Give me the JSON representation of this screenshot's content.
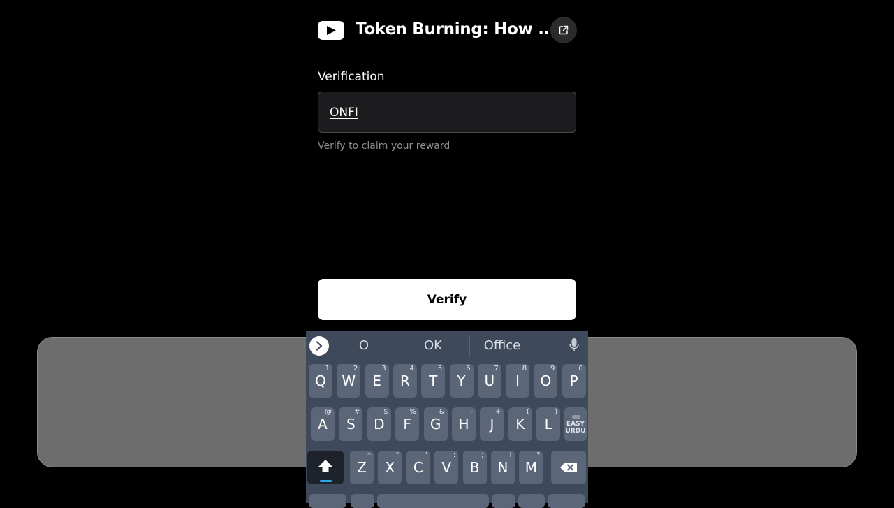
{
  "header": {
    "app_icon": "youtube-icon",
    "title": "Token Burning: How ...",
    "external_link_icon": "external-link-icon"
  },
  "form": {
    "label": "Verification",
    "input_value": "ONFI",
    "helper_text": "Verify to claim your reward",
    "submit_label": "Verify"
  },
  "keyboard": {
    "suggestions": [
      "O",
      "OK",
      "Office"
    ],
    "expand_icon": "chevron-right-icon",
    "mic_icon": "microphone-icon",
    "row1": [
      {
        "key": "Q",
        "alt": "1"
      },
      {
        "key": "W",
        "alt": "2"
      },
      {
        "key": "E",
        "alt": "3"
      },
      {
        "key": "R",
        "alt": "4"
      },
      {
        "key": "T",
        "alt": "5"
      },
      {
        "key": "Y",
        "alt": "6"
      },
      {
        "key": "U",
        "alt": "7"
      },
      {
        "key": "I",
        "alt": "8"
      },
      {
        "key": "O",
        "alt": "9"
      },
      {
        "key": "P",
        "alt": "0"
      }
    ],
    "row2": [
      {
        "key": "A",
        "alt": "@"
      },
      {
        "key": "S",
        "alt": "#"
      },
      {
        "key": "D",
        "alt": "$"
      },
      {
        "key": "F",
        "alt": "%"
      },
      {
        "key": "G",
        "alt": "&"
      },
      {
        "key": "H",
        "alt": "-"
      },
      {
        "key": "J",
        "alt": "+"
      },
      {
        "key": "K",
        "alt": "("
      },
      {
        "key": "L",
        "alt": ")"
      }
    ],
    "urdu_key_label": "EASY URDU",
    "row3": [
      {
        "key": "Z",
        "alt": "*"
      },
      {
        "key": "X",
        "alt": "\""
      },
      {
        "key": "C",
        "alt": "'"
      },
      {
        "key": "V",
        "alt": ":"
      },
      {
        "key": "B",
        "alt": ";"
      },
      {
        "key": "N",
        "alt": "!"
      },
      {
        "key": "M",
        "alt": "?"
      }
    ],
    "shift_icon": "shift-icon",
    "backspace_icon": "backspace-icon"
  },
  "colors": {
    "background": "#000000",
    "keyboard_bg": "#3e4a5c",
    "key_bg": "#5b6679",
    "shift_indicator": "#2aa6e0",
    "overlay_panel": "#6d6d6d"
  }
}
